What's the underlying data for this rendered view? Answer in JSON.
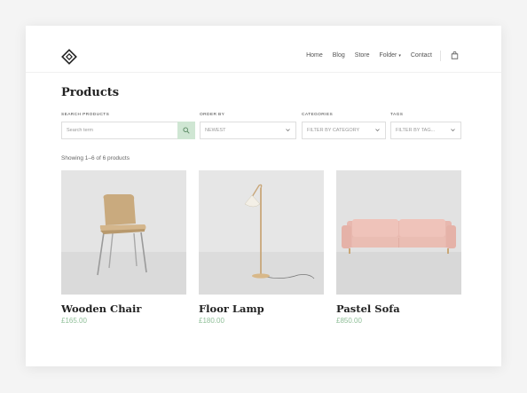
{
  "nav": {
    "items": [
      "Home",
      "Blog",
      "Store",
      "Folder",
      "Contact"
    ],
    "folder_caret": "▾"
  },
  "page": {
    "title": "Products"
  },
  "filters": {
    "search": {
      "label": "SEARCH PRODUCTS",
      "placeholder": "Search term"
    },
    "order": {
      "label": "ORDER BY",
      "value": "NEWEST"
    },
    "categories": {
      "label": "CATEGORIES",
      "value": "FILTER BY CATEGORY"
    },
    "tags": {
      "label": "TAGS",
      "value": "FILTER BY TAG..."
    }
  },
  "results": {
    "count_text": "Showing 1–6 of 6 products"
  },
  "products": [
    {
      "name": "Wooden Chair",
      "price": "£165.00"
    },
    {
      "name": "Floor Lamp",
      "price": "£180.00"
    },
    {
      "name": "Pastel Sofa",
      "price": "£850.00"
    }
  ],
  "colors": {
    "accent": "#8fbf98",
    "search_button": "#cfe6d3"
  },
  "icons": [
    "logo-diamond-icon",
    "shopping-bag-icon",
    "search-icon",
    "chevron-down-icon"
  ]
}
